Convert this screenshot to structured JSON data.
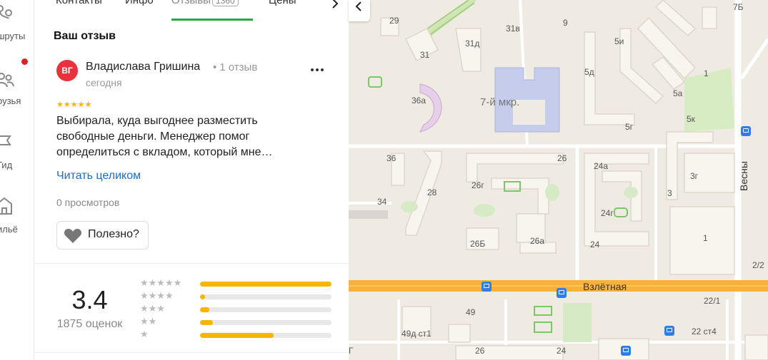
{
  "rail": {
    "items": [
      {
        "label": "шруты",
        "icon": "routes-icon"
      },
      {
        "label": "рузья",
        "icon": "friends-icon"
      },
      {
        "label": "Гид",
        "icon": "guide-flag-icon"
      },
      {
        "label": "ильё",
        "icon": "housing-icon"
      }
    ]
  },
  "tabs": [
    {
      "label": "Контакты"
    },
    {
      "label": "Инфо"
    },
    {
      "label": "Отзывы",
      "count": "1360"
    },
    {
      "label": "Цены"
    }
  ],
  "review": {
    "section_title": "Ваш отзыв",
    "avatar_initials": "ВГ",
    "author": "Владислава Гришина",
    "author_reviews": "1 отзыв",
    "separator": "•",
    "date": "сегодня",
    "stars": "★★★★★",
    "text": "Выбирала, куда выгоднее разместить свободные деньги. Менеджер помог определиться с вкладом, который мне…",
    "read_more": "Читать целиком",
    "views": "0 просмотров",
    "useful_label": "Полезно?"
  },
  "rating": {
    "value": "3.4",
    "total": "1875 оценок",
    "distribution": [
      {
        "stars": "★★★★★",
        "fraction": 1.0
      },
      {
        "stars": "★★★★",
        "fraction": 0.04
      },
      {
        "stars": "★★★",
        "fraction": 0.07
      },
      {
        "stars": "★★",
        "fraction": 0.1
      },
      {
        "stars": "★",
        "fraction": 0.56
      }
    ]
  },
  "map": {
    "labels": {
      "district": "7-й мкр.",
      "street": "Взлётная",
      "street2": "Весны",
      "b29": "29",
      "b31": "31",
      "b31d": "31д",
      "b31v": "31в",
      "b9": "9",
      "b7b": "7Б",
      "b5i": "5и",
      "b5d": "5д",
      "b1": "1",
      "b5a": "5а",
      "b5k": "5к",
      "b5g": "5г",
      "b36a": "36а",
      "b36": "36",
      "b28": "28",
      "b26": "26",
      "b24a": "24а",
      "b3g": "3г",
      "b26g": "26г",
      "b34": "34",
      "b24g": "24г",
      "b3": "3",
      "b1b": "1",
      "b26b": "26Б",
      "b26a": "26а",
      "b24": "24",
      "b2_2": "2/2",
      "b49": "49",
      "b22_1": "22/1",
      "b49d": "49д ст1",
      "b22": "22 ст4",
      "b26c": "26",
      "b24c": "24",
      "bg": "Г"
    }
  },
  "colors": {
    "accent_green": "#2da64b",
    "star_yellow": "#f7b500",
    "link_blue": "#1a6dcc",
    "avatar_red": "#e8333c",
    "road_orange": "#f6b23a"
  }
}
